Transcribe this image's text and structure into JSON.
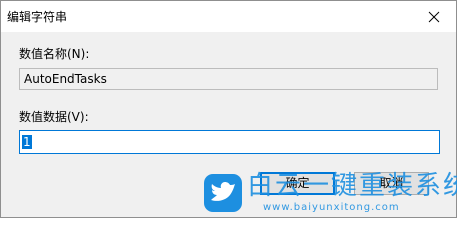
{
  "window": {
    "title": "编辑字符串",
    "close_icon": "close-icon"
  },
  "form": {
    "name_label": "数值名称(N):",
    "name_value": "AutoEndTasks",
    "data_label": "数值数据(V):",
    "data_value": "1"
  },
  "buttons": {
    "ok_label": "确定",
    "cancel_label": "取消"
  },
  "watermark": {
    "title": "白云一键重装系统",
    "url": "www.baiyunxitong.com",
    "logo_icon": "bird-logo-icon"
  },
  "colors": {
    "accent": "#0078d7",
    "watermark": "#1d8fe0"
  }
}
